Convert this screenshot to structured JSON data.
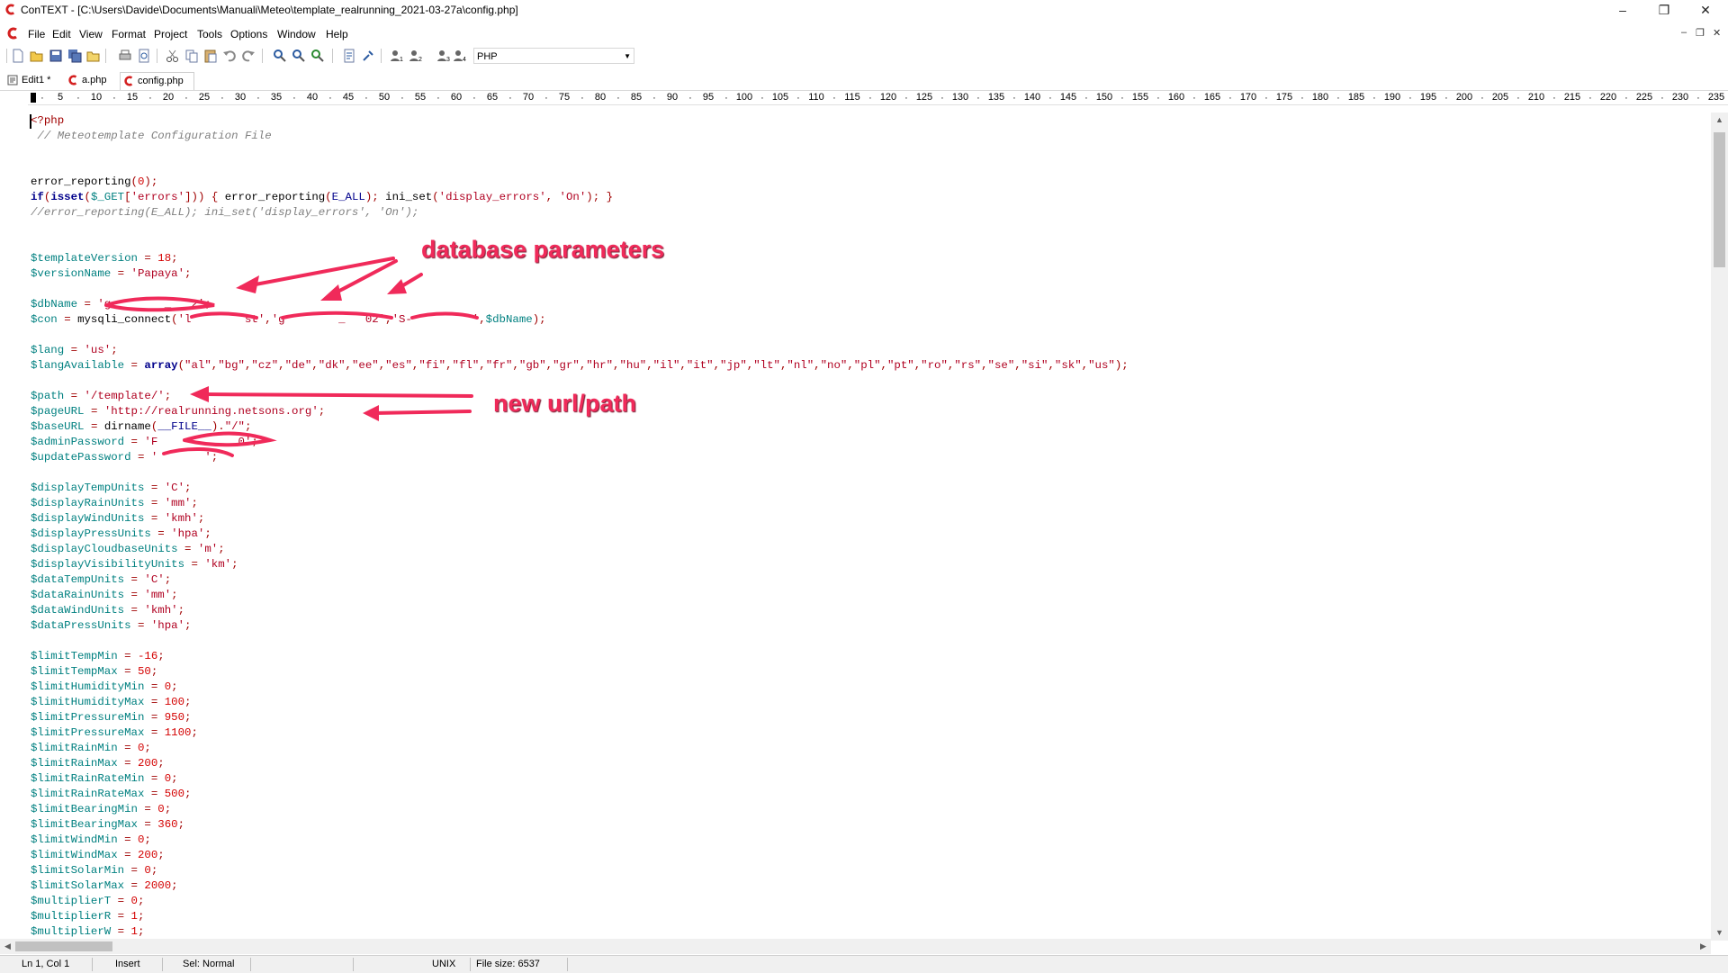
{
  "window": {
    "title": "ConTEXT - [C:\\Users\\Davide\\Documents\\Manuali\\Meteo\\template_realrunning_2021-03-27a\\config.php]",
    "minimize": "–",
    "maximize": "❐",
    "close": "✕"
  },
  "menu": {
    "items": [
      "File",
      "Edit",
      "View",
      "Format",
      "Project",
      "Tools",
      "Options",
      "Window",
      "Help"
    ],
    "mdi_minimize": "–",
    "mdi_restore": "❐",
    "mdi_close": "✕"
  },
  "toolbar": {
    "language_select": "PHP"
  },
  "tabs": [
    {
      "label": "Edit1 *",
      "icon": "text-file-icon"
    },
    {
      "label": "a.php",
      "icon": "context-file-icon"
    },
    {
      "label": "config.php",
      "icon": "context-file-icon",
      "active": true
    }
  ],
  "ruler": {
    "numbers": [
      "5",
      "10",
      "15",
      "20",
      "25",
      "30",
      "35",
      "40",
      "45",
      "50",
      "55",
      "60",
      "65",
      "70",
      "75",
      "80",
      "85",
      "90",
      "95",
      "100",
      "105",
      "110",
      "115",
      "120",
      "125",
      "130",
      "135",
      "140",
      "145",
      "150",
      "155",
      "160",
      "165",
      "170",
      "175",
      "180",
      "185",
      "190",
      "195",
      "200",
      "205",
      "210",
      "215",
      "220",
      "225",
      "230",
      "235"
    ]
  },
  "code": {
    "lines": [
      "<?php",
      " // Meteotemplate Configuration File",
      "",
      "",
      "error_reporting(0);",
      "if(isset($_GET['errors'])) { error_reporting(E_ALL); ini_set('display_errors', 'On'); }",
      "//error_reporting(E_ALL); ini_set('display_errors', 'On');",
      "",
      "",
      "$templateVersion = 18;",
      "$versionName = 'Papaya';",
      "",
      "$dbName = 'g        _   2';",
      "$con = mysqli_connect('l        st','g        _   02','S-         ',$dbName);",
      "",
      "$lang = 'us';",
      "$langAvailable = array(\"al\",\"bg\",\"cz\",\"de\",\"dk\",\"ee\",\"es\",\"fi\",\"fl\",\"fr\",\"gb\",\"gr\",\"hr\",\"hu\",\"il\",\"it\",\"jp\",\"lt\",\"nl\",\"no\",\"pl\",\"pt\",\"ro\",\"rs\",\"se\",\"si\",\"sk\",\"us\");",
      "",
      "$path = '/template/';",
      "$pageURL = 'http://realrunning.netsons.org';",
      "$baseURL = dirname(__FILE__).\"/\";",
      "$adminPassword = 'F            0';",
      "$updatePassword = '       ';",
      "",
      "$displayTempUnits = 'C';",
      "$displayRainUnits = 'mm';",
      "$displayWindUnits = 'kmh';",
      "$displayPressUnits = 'hpa';",
      "$displayCloudbaseUnits = 'm';",
      "$displayVisibilityUnits = 'km';",
      "$dataTempUnits = 'C';",
      "$dataRainUnits = 'mm';",
      "$dataWindUnits = 'kmh';",
      "$dataPressUnits = 'hpa';",
      "",
      "$limitTempMin = -16;",
      "$limitTempMax = 50;",
      "$limitHumidityMin = 0;",
      "$limitHumidityMax = 100;",
      "$limitPressureMin = 950;",
      "$limitPressureMax = 1100;",
      "$limitRainMin = 0;",
      "$limitRainMax = 200;",
      "$limitRainRateMin = 0;",
      "$limitRainRateMax = 500;",
      "$limitBearingMin = 0;",
      "$limitBearingMax = 360;",
      "$limitWindMin = 0;",
      "$limitWindMax = 200;",
      "$limitSolarMin = 0;",
      "$limitSolarMax = 2000;",
      "$multiplierT = 0;",
      "$multiplierR = 1;",
      "$multiplierW = 1;"
    ]
  },
  "annotations": {
    "database": "database parameters",
    "url": "new url/path",
    "color": "#f02a5a"
  },
  "statusbar": {
    "position": "Ln 1, Col 1",
    "mode": "Insert",
    "selection": "Sel: Normal",
    "line_endings": "UNIX",
    "file_size": "File size: 6537"
  }
}
